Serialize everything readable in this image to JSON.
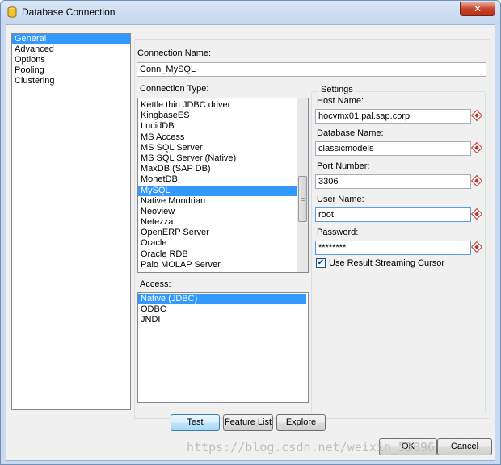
{
  "window": {
    "title": "Database Connection",
    "close_glyph": "✕"
  },
  "nav": {
    "items": [
      "General",
      "Advanced",
      "Options",
      "Pooling",
      "Clustering"
    ],
    "selected_index": 0
  },
  "connection_name": {
    "label": "Connection Name:",
    "value": "Conn_MySQL"
  },
  "connection_type": {
    "label": "Connection Type:",
    "items": [
      "Kettle thin JDBC driver",
      "KingbaseES",
      "LucidDB",
      "MS Access",
      "MS SQL Server",
      "MS SQL Server (Native)",
      "MaxDB (SAP DB)",
      "MonetDB",
      "MySQL",
      "Native Mondrian",
      "Neoview",
      "Netezza",
      "OpenERP Server",
      "Oracle",
      "Oracle RDB",
      "Palo MOLAP Server"
    ],
    "selected_index": 8
  },
  "access": {
    "label": "Access:",
    "items": [
      "Native (JDBC)",
      "ODBC",
      "JNDI"
    ],
    "selected_index": 0
  },
  "settings": {
    "legend": "Settings",
    "host_name": {
      "label": "Host Name:",
      "value": "hocvmx01.pal.sap.corp"
    },
    "database_name": {
      "label": "Database Name:",
      "value": "classicmodels"
    },
    "port_number": {
      "label": "Port Number:",
      "value": "3306"
    },
    "user_name": {
      "label": "User Name:",
      "value": "root"
    },
    "password": {
      "label": "Password:",
      "value": "********"
    },
    "streaming": {
      "label": "Use Result Streaming Cursor",
      "checked": true,
      "mark": "✔"
    }
  },
  "buttons": {
    "test": "Test",
    "feature_list": "Feature List",
    "explore": "Explore",
    "ok": "OK",
    "cancel": "Cancel"
  },
  "watermark": "https://blog.csdn.net/weixin_53096",
  "colors": {
    "selection": "#3399ff",
    "title_bar": "#c5d7ef",
    "required_marker": "#c0392b"
  }
}
